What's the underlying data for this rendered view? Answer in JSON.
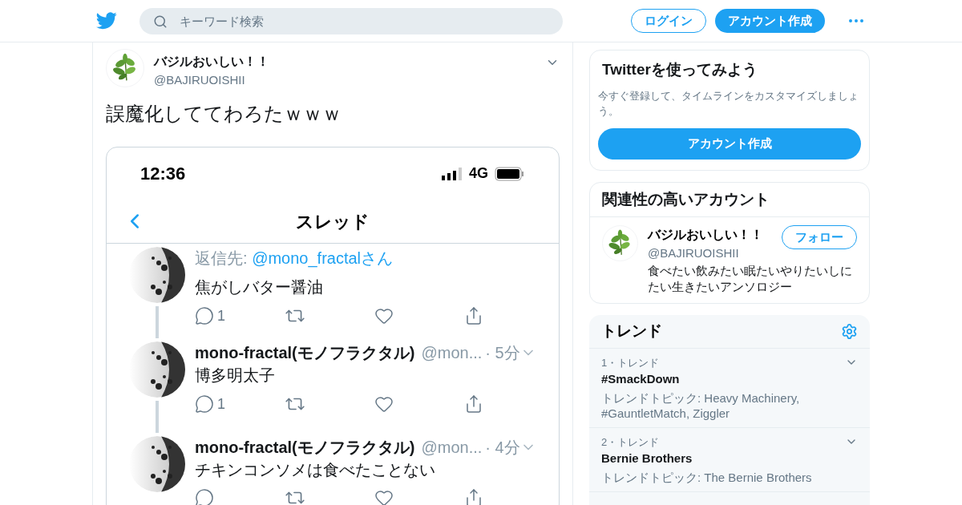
{
  "header": {
    "search_placeholder": "キーワード検索",
    "login": "ログイン",
    "signup": "アカウント作成"
  },
  "tweet": {
    "name": "バジルおいしい！！",
    "handle": "@BAJIRUOISHII",
    "text": "誤魔化しててわろたｗｗｗ",
    "screenshot": {
      "time": "12:36",
      "network": "4G",
      "title": "スレッド",
      "posts": [
        {
          "kind": "reply",
          "reply_prefix": "返信先: ",
          "reply_to": "@mono_fractalさん",
          "text": "焦がしバター醤油",
          "reply_count": "1"
        },
        {
          "kind": "full",
          "name": "mono-fractal(モノフラクタル)",
          "handle": "@mon...",
          "time": "· 5分",
          "text": "博多明太子",
          "reply_count": "1"
        },
        {
          "kind": "full",
          "name": "mono-fractal(モノフラクタル)",
          "handle": "@mon...",
          "time": "· 4分",
          "text": "チキンコンソメは食べたことない"
        }
      ]
    }
  },
  "signup_card": {
    "title": "Twitterを使ってみよう",
    "text": "今すぐ登録して、タイムラインをカスタマイズしましょう。",
    "button": "アカウント作成"
  },
  "related": {
    "title": "関連性の高いアカウント",
    "accounts": [
      {
        "name": "バジルおいしい！！",
        "handle": "@BAJIRUOISHII",
        "bio": "食べたい飲みたい眠たいやりたいしにたい生きたいアンソロジー",
        "follow": "フォロー"
      }
    ]
  },
  "trends": {
    "title": "トレンド",
    "items": [
      {
        "rank": "1・トレンド",
        "name": "#SmackDown",
        "topics": "トレンドトピック: Heavy Machinery, #GauntletMatch, Ziggler"
      },
      {
        "rank": "2・トレンド",
        "name": "Bernie Brothers",
        "topics": "トレンドトピック: The Bernie Brothers"
      }
    ]
  }
}
